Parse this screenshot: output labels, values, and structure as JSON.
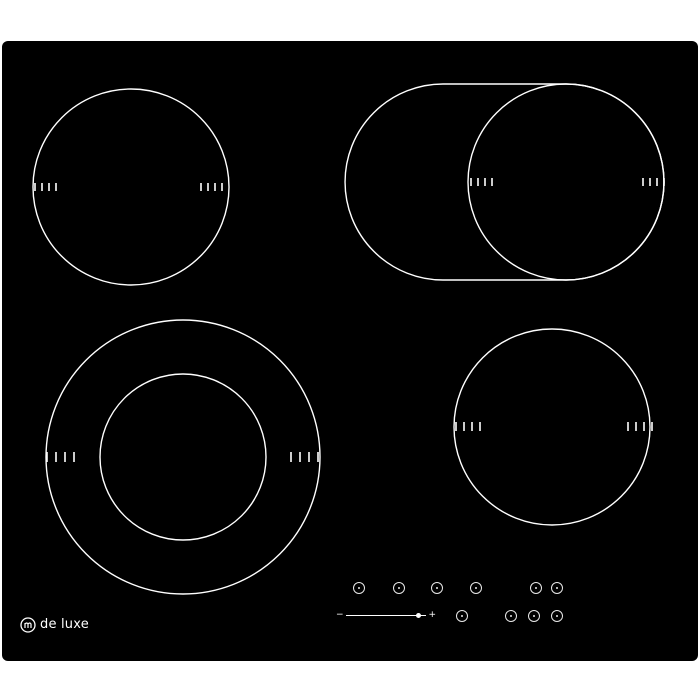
{
  "brand": {
    "name": "de luxe",
    "logo_icon": "deluxe-logo-icon"
  },
  "colors": {
    "glass": "#000000",
    "markings": "#ffffff",
    "background": "#ffffff"
  },
  "cooking_zones": [
    {
      "id": "zone-rear-left",
      "shape": "single-circle",
      "tick_marks": 4
    },
    {
      "id": "zone-rear-right",
      "shape": "oval-bridge-zone",
      "tick_marks": 4
    },
    {
      "id": "zone-front-left",
      "shape": "dual-circle",
      "tick_marks": 4
    },
    {
      "id": "zone-front-right",
      "shape": "single-circle",
      "tick_marks": 4
    }
  ],
  "controls": {
    "zone_selectors": [
      {
        "icon": "zone-front-left-select-icon"
      },
      {
        "icon": "zone-rear-left-select-icon"
      },
      {
        "icon": "zone-rear-right-select-icon"
      },
      {
        "icon": "zone-front-right-select-icon"
      }
    ],
    "timer": {
      "icon": "timer-icon"
    },
    "lock": {
      "icon": "lock-icon"
    },
    "slider": {
      "minus": "−",
      "plus": "+",
      "level": 0.9
    },
    "dual_zone": {
      "icon": "dual-zone-icon"
    },
    "bridge": {
      "icon": "bridge-zone-icon"
    },
    "pause": {
      "icon": "pause-icon"
    },
    "power": {
      "icon": "power-icon"
    }
  }
}
